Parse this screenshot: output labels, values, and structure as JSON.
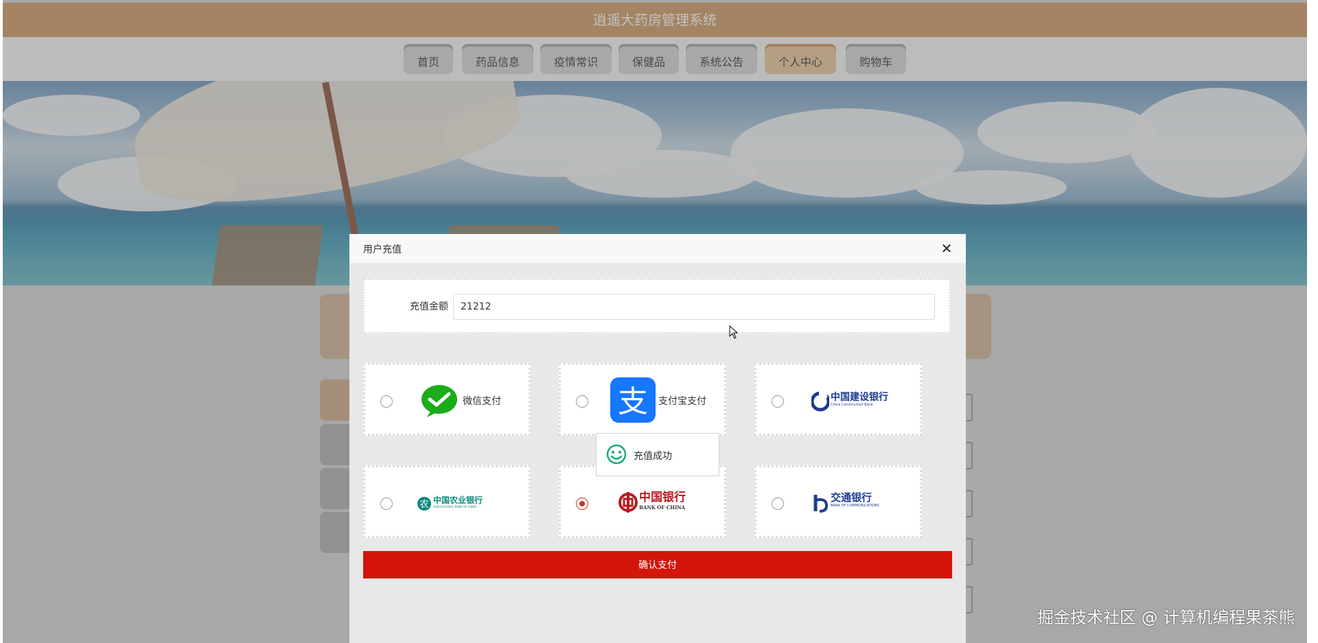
{
  "app": {
    "title": "逍遥大药房管理系统"
  },
  "nav": {
    "items": [
      {
        "label": "首页"
      },
      {
        "label": "药品信息"
      },
      {
        "label": "疫情常识"
      },
      {
        "label": "保健品"
      },
      {
        "label": "系统公告"
      },
      {
        "label": "个人中心",
        "active": true
      },
      {
        "label": "购物车"
      }
    ]
  },
  "modal": {
    "title": "用户充值",
    "close_icon": "close-icon",
    "amount_label": "充值金额",
    "amount_value": "21212",
    "payment_options": [
      {
        "label": "微信支付",
        "icon": "wechat-pay-icon",
        "selected": false
      },
      {
        "label": "支付宝支付",
        "icon": "alipay-icon",
        "selected": false
      },
      {
        "label": "中国建设银行",
        "sublabel": "China Construction Bank",
        "icon": "ccb-logo-icon",
        "selected": false
      },
      {
        "label": "中国农业银行",
        "sublabel": "AGRICULTURAL BANK OF CHINA",
        "icon": "abc-logo-icon",
        "selected": false
      },
      {
        "label": "中国银行",
        "sublabel": "BANK OF CHINA",
        "icon": "boc-logo-icon",
        "selected": true
      },
      {
        "label": "交通银行",
        "sublabel": "BANK OF COMMUNICATIONS",
        "icon": "bocom-logo-icon",
        "selected": false
      }
    ],
    "confirm_label": "确认支付"
  },
  "toast": {
    "text": "充值成功",
    "icon": "smile-icon"
  },
  "watermark": {
    "text": "掘金技术社区 @ 计算机编程果茶熊"
  },
  "colors": {
    "brand": "#c98e53",
    "active_nav": "#e7c08e",
    "confirm": "#d3150b",
    "radio_checked": "#d23228",
    "wechat": "#1aad19",
    "alipay": "#1677ff",
    "ccb": "#1e3d8f",
    "abc": "#0e8a7a",
    "boc": "#b81c22",
    "bocom": "#1c3d8f"
  }
}
